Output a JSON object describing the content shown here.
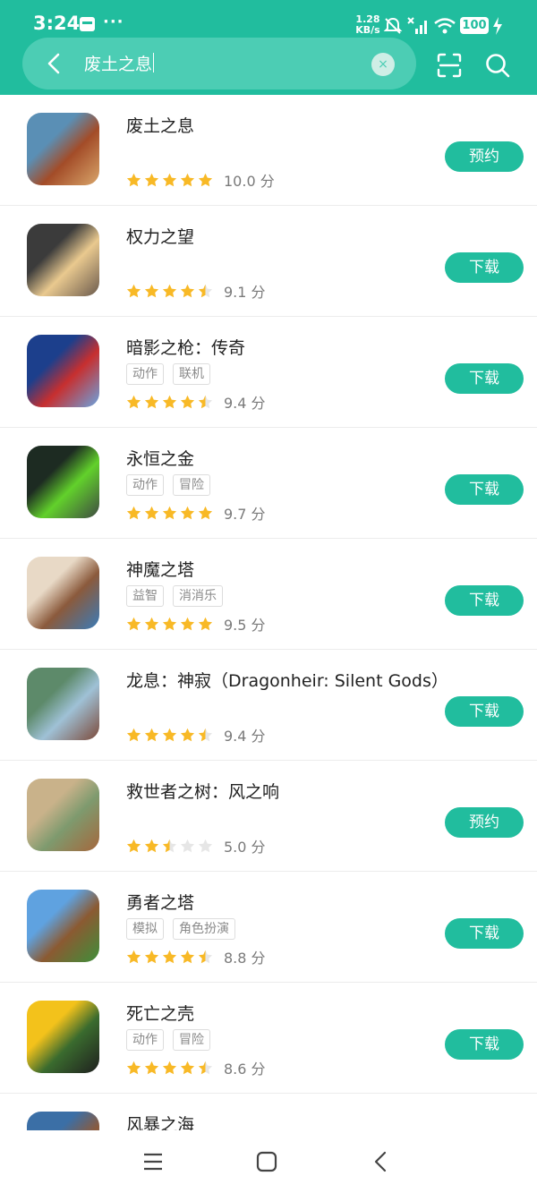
{
  "status": {
    "time": "3:24",
    "dots": "···",
    "net_speed_value": "1.28",
    "net_speed_unit": "KB/s",
    "battery": "100"
  },
  "search": {
    "query": "废土之息",
    "clear_symbol": "×"
  },
  "games": [
    {
      "name": "废土之息",
      "tags": [],
      "stars": 5,
      "score": "10.0 分",
      "action": "预约",
      "icon_colors": [
        "#5a8fb5",
        "#a34c28",
        "#d9a66b"
      ]
    },
    {
      "name": "权力之望",
      "tags": [],
      "stars": 4.5,
      "score": "9.1 分",
      "action": "下载",
      "icon_colors": [
        "#3b3b3b",
        "#e9c98f",
        "#6b5a4c"
      ]
    },
    {
      "name": "暗影之枪：传奇",
      "tags": [
        "动作",
        "联机"
      ],
      "stars": 4.5,
      "score": "9.4 分",
      "action": "下载",
      "icon_colors": [
        "#1c3f8c",
        "#c72f2f",
        "#6aa4e0"
      ]
    },
    {
      "name": "永恒之金",
      "tags": [
        "动作",
        "冒险"
      ],
      "stars": 5,
      "score": "9.7 分",
      "action": "下载",
      "icon_colors": [
        "#1d2b22",
        "#62d12b",
        "#3f4a42"
      ]
    },
    {
      "name": "神魔之塔",
      "tags": [
        "益智",
        "消消乐"
      ],
      "stars": 5,
      "score": "9.5 分",
      "action": "下载",
      "icon_colors": [
        "#e8d9c6",
        "#8b5a3c",
        "#3a7bb8"
      ]
    },
    {
      "name": "龙息：神寂（Dragonheir: Silent Gods）",
      "tags": [],
      "stars": 4.5,
      "score": "9.4 分",
      "action": "下载",
      "icon_colors": [
        "#5d8a6a",
        "#9fc1d6",
        "#7c4a3a"
      ]
    },
    {
      "name": "救世者之树：风之响",
      "tags": [],
      "stars": 2.5,
      "score": "5.0 分",
      "action": "预约",
      "icon_colors": [
        "#c9b28a",
        "#7e9a6e",
        "#a5673c"
      ]
    },
    {
      "name": "勇者之塔",
      "tags": [
        "模拟",
        "角色扮演"
      ],
      "stars": 4.5,
      "score": "8.8 分",
      "action": "下载",
      "icon_colors": [
        "#5fa2e0",
        "#8b5a32",
        "#3e8f3a"
      ]
    },
    {
      "name": "死亡之壳",
      "tags": [
        "动作",
        "冒险"
      ],
      "stars": 4.5,
      "score": "8.6 分",
      "action": "下载",
      "icon_colors": [
        "#f3c21b",
        "#3a6b2e",
        "#1f1f1f"
      ]
    },
    {
      "name": "风暴之海",
      "tags": [],
      "stars": 0,
      "score": "",
      "action": "",
      "icon_colors": [
        "#3b6fa6",
        "#8b5a3c",
        "#6ba0d0"
      ]
    }
  ],
  "colors": {
    "accent": "#21bd9e",
    "star_on": "#f8b926",
    "star_off": "#e6e6e6"
  },
  "navbar": {
    "items": [
      "menu-icon",
      "home-icon",
      "back-icon"
    ]
  }
}
